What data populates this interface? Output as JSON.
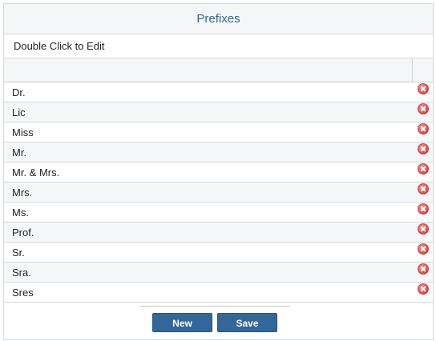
{
  "panel": {
    "title": "Prefixes",
    "hint": "Double Click to Edit"
  },
  "grid": {
    "rows": [
      {
        "label": "Dr."
      },
      {
        "label": "Lic"
      },
      {
        "label": "Miss"
      },
      {
        "label": "Mr."
      },
      {
        "label": "Mr. & Mrs."
      },
      {
        "label": "Mrs."
      },
      {
        "label": "Ms."
      },
      {
        "label": "Prof."
      },
      {
        "label": "Sr."
      },
      {
        "label": "Sra."
      },
      {
        "label": "Sres"
      }
    ],
    "delete_icon": "delete-circle-x-icon"
  },
  "footer": {
    "new_label": "New",
    "save_label": "Save"
  },
  "colors": {
    "title": "#336699",
    "button": "#336699",
    "delete": "#d84a4a"
  }
}
